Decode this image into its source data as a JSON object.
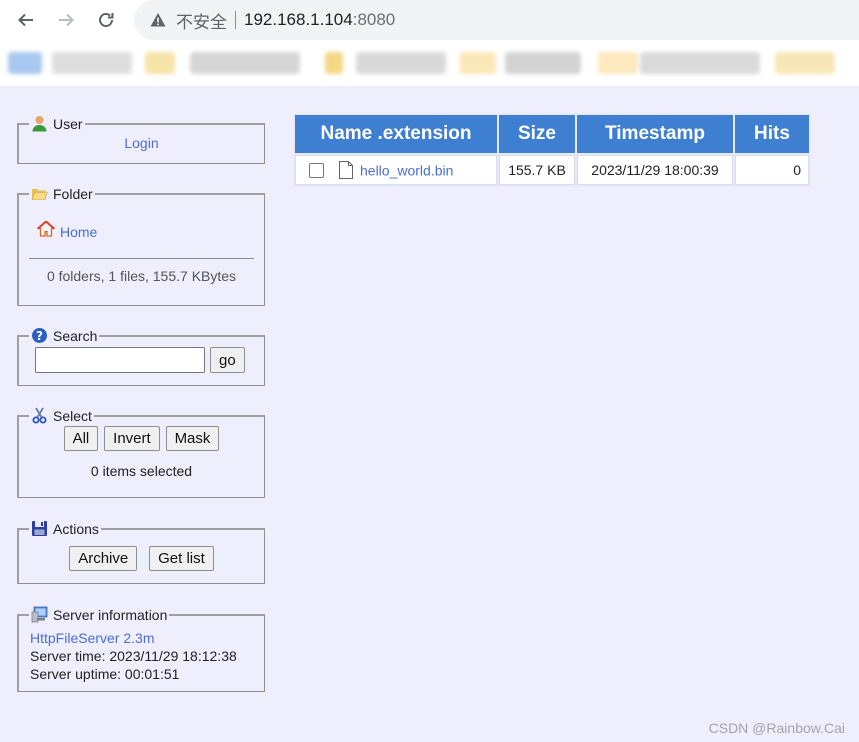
{
  "browser": {
    "security_label": "不安全",
    "url_host": "192.168.1.104",
    "url_port": ":8080",
    "bookmark_chips": [
      {
        "color": "#a8c8ef"
      },
      {
        "color": "#dedede"
      },
      {
        "color": "#f6e3a7"
      },
      {
        "color": "#d6d6d6"
      },
      {
        "color": "#f3d885"
      },
      {
        "color": "#d9d9d9"
      },
      {
        "color": "#fbe8b8"
      },
      {
        "color": "#d3d3d3"
      },
      {
        "color": "#fce9bd"
      },
      {
        "color": "#dadada"
      },
      {
        "color": "#f7e7b6"
      }
    ]
  },
  "sidebar": {
    "user": {
      "legend": "User",
      "login": "Login"
    },
    "folder": {
      "legend": "Folder",
      "home": "Home",
      "summary": "0 folders, 1 files, 155.7 KBytes"
    },
    "search": {
      "legend": "Search",
      "placeholder": "",
      "value": "",
      "go": "go"
    },
    "select": {
      "legend": "Select",
      "all": "All",
      "invert": "Invert",
      "mask": "Mask",
      "status": "0 items selected"
    },
    "actions": {
      "legend": "Actions",
      "archive": "Archive",
      "get_list": "Get list"
    },
    "server": {
      "legend": "Server information",
      "software": "HttpFileServer 2.3m",
      "time": "Server time: 2023/11/29 18:12:38",
      "uptime": "Server uptime: 00:01:51"
    }
  },
  "table": {
    "headers": [
      "Name .extension",
      "Size",
      "Timestamp",
      "Hits"
    ],
    "rows": [
      {
        "name": "hello_world.bin",
        "size": "155.7 KB",
        "timestamp": "2023/11/29 18:00:39",
        "hits": "0"
      }
    ]
  },
  "watermark": "CSDN @Rainbow.Cai",
  "colors": {
    "page_background": "#eeeefd",
    "header_background": "#3f7fd2",
    "link": "#4a6fd0"
  }
}
